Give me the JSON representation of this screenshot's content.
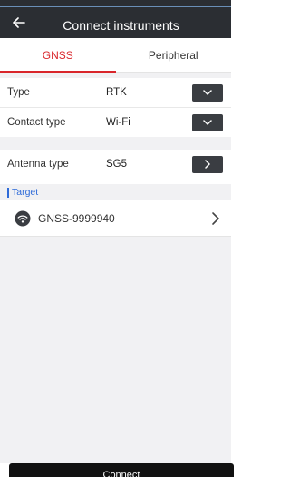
{
  "header": {
    "title": "Connect instruments",
    "back_icon": "arrow-left-icon"
  },
  "tabs": [
    {
      "label": "GNSS",
      "active": true
    },
    {
      "label": "Peripheral",
      "active": false
    }
  ],
  "form": {
    "type": {
      "label": "Type",
      "value": "RTK",
      "control": "chevron-down-icon"
    },
    "contact_type": {
      "label": "Contact type",
      "value": "Wi-Fi",
      "control": "chevron-down-icon"
    },
    "antenna_type": {
      "label": "Antenna type",
      "value": "SG5",
      "control": "chevron-right-icon"
    }
  },
  "target": {
    "heading": "Target",
    "device": {
      "name": "GNSS-9999940",
      "icon": "wifi-icon"
    }
  },
  "footer": {
    "connect_label": "Connect"
  },
  "colors": {
    "header_bg": "#2b2e33",
    "accent_red": "#d9262b",
    "accent_blue": "#2f6bd8",
    "button_dark": "#3a3d42",
    "page_bg": "#f1f1f3"
  }
}
